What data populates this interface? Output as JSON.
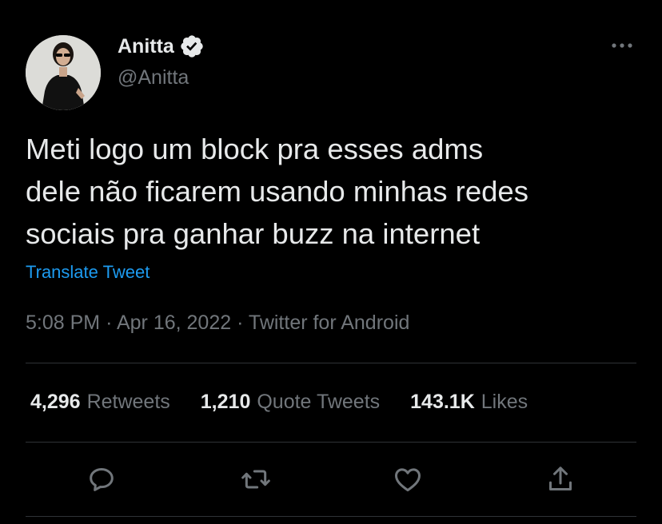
{
  "author": {
    "display_name": "Anitta",
    "handle": "@Anitta",
    "verified": true
  },
  "tweet": {
    "text": "Meti logo um block pra esses adms\ndele não ficarem usando minhas redes\nsociais pra ganhar buzz na internet",
    "translate_label": "Translate Tweet",
    "time": "5:08 PM",
    "date": "Apr 16, 2022",
    "source": "Twitter for Android",
    "separator": "·"
  },
  "stats": {
    "retweets": {
      "count": "4,296",
      "label": "Retweets"
    },
    "quotes": {
      "count": "1,210",
      "label": "Quote Tweets"
    },
    "likes": {
      "count": "143.1K",
      "label": "Likes"
    }
  },
  "icons": {
    "more": "more-icon",
    "reply": "reply-icon",
    "retweet": "retweet-icon",
    "like": "heart-icon",
    "share": "share-icon",
    "verified": "verified-badge-icon"
  },
  "colors": {
    "background": "#000000",
    "text": "#e7e9ea",
    "secondary": "#71767b",
    "accent": "#1d9bf0",
    "divider": "#2f3336"
  }
}
